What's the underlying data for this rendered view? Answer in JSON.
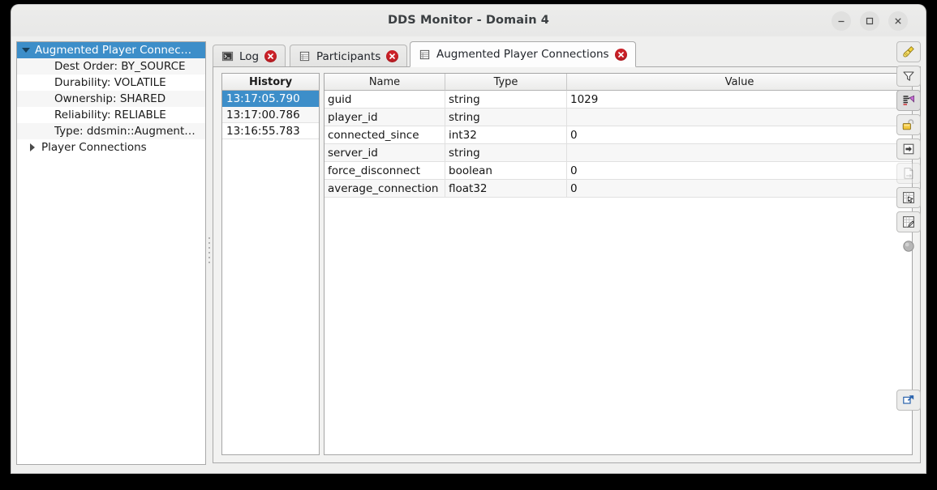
{
  "window": {
    "title": "DDS Monitor - Domain 4",
    "controls": {
      "minimize": "Minimize",
      "maximize": "Maximize",
      "close": "Close"
    }
  },
  "tree": {
    "nodes": [
      {
        "label": "Augmented Player Connec…",
        "state": "expanded",
        "selected": true
      },
      {
        "label": "Dest Order: BY_SOURCE",
        "state": "leaf",
        "selected": false
      },
      {
        "label": "Durability: VOLATILE",
        "state": "leaf",
        "selected": false
      },
      {
        "label": "Ownership: SHARED",
        "state": "leaf",
        "selected": false
      },
      {
        "label": "Reliability: RELIABLE",
        "state": "leaf",
        "selected": false
      },
      {
        "label": "Type: ddsmin::Augment…",
        "state": "leaf",
        "selected": false
      },
      {
        "label": "Player Connections",
        "state": "collapsed",
        "selected": false
      }
    ]
  },
  "tabs": [
    {
      "label": "Log",
      "icon": "terminal-icon",
      "active": false,
      "closable": true
    },
    {
      "label": "Participants",
      "icon": "table-icon",
      "active": false,
      "closable": true
    },
    {
      "label": "Augmented Player Connections",
      "icon": "table-icon",
      "active": true,
      "closable": true
    }
  ],
  "history": {
    "header": "History",
    "rows": [
      {
        "time": "13:17:05.790",
        "selected": true
      },
      {
        "time": "13:17:00.786",
        "selected": false
      },
      {
        "time": "13:16:55.783",
        "selected": false
      }
    ]
  },
  "table": {
    "headers": {
      "name": "Name",
      "type": "Type",
      "value": "Value"
    },
    "rows": [
      {
        "name": "guid",
        "type": "string",
        "value": "1029"
      },
      {
        "name": "player_id",
        "type": "string",
        "value": ""
      },
      {
        "name": "connected_since",
        "type": "int32",
        "value": "0"
      },
      {
        "name": "server_id",
        "type": "string",
        "value": ""
      },
      {
        "name": "force_disconnect",
        "type": "boolean",
        "value": "0"
      },
      {
        "name": "average_connection",
        "type": "float32",
        "value": "0"
      }
    ]
  },
  "toolbar": {
    "buttons": [
      {
        "name": "clear-icon",
        "tooltip": "Clear"
      },
      {
        "name": "filter-icon",
        "tooltip": "Filter"
      },
      {
        "name": "edit-list-icon",
        "tooltip": "Edit columns"
      },
      {
        "name": "unlock-icon",
        "tooltip": "Unlock"
      },
      {
        "name": "export-icon",
        "tooltip": "Export"
      },
      {
        "name": "copy-document-icon",
        "tooltip": "Copy",
        "disabled": true
      },
      {
        "name": "table-select-icon",
        "tooltip": "Select table"
      },
      {
        "name": "table-edit-icon",
        "tooltip": "Edit table"
      },
      {
        "name": "record-icon",
        "tooltip": "Record"
      },
      {
        "name": "popout-icon",
        "tooltip": "Open in new window"
      }
    ]
  },
  "colors": {
    "selection": "#3d8ec9",
    "close_badge": "#cc2128",
    "accent_blue": "#2a63ad",
    "window_bg": "#efefee"
  }
}
